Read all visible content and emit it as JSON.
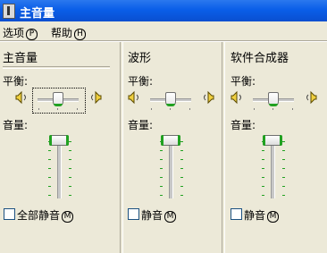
{
  "window": {
    "title": "主音量"
  },
  "menu": [
    {
      "label": "选项",
      "hotkey": "P"
    },
    {
      "label": "帮助",
      "hotkey": "H"
    }
  ],
  "channels": [
    {
      "title": "主音量",
      "balance_label": "平衡:",
      "volume_label": "音量:",
      "mute_label": "全部静音",
      "mute_hotkey": "M",
      "muted": false,
      "balance": 0.5,
      "volume": 1.0
    },
    {
      "title": "波形",
      "balance_label": "平衡:",
      "volume_label": "音量:",
      "mute_label": "静音",
      "mute_hotkey": "M",
      "muted": false,
      "balance": 0.5,
      "volume": 1.0
    },
    {
      "title": "软件合成器",
      "balance_label": "平衡:",
      "volume_label": "音量:",
      "mute_label": "静音",
      "mute_hotkey": "M",
      "muted": false,
      "balance": 0.5,
      "volume": 1.0
    }
  ],
  "colors": {
    "titlebar": "#0a5ee8",
    "accent": "#21a121",
    "face": "#ece9d8"
  }
}
